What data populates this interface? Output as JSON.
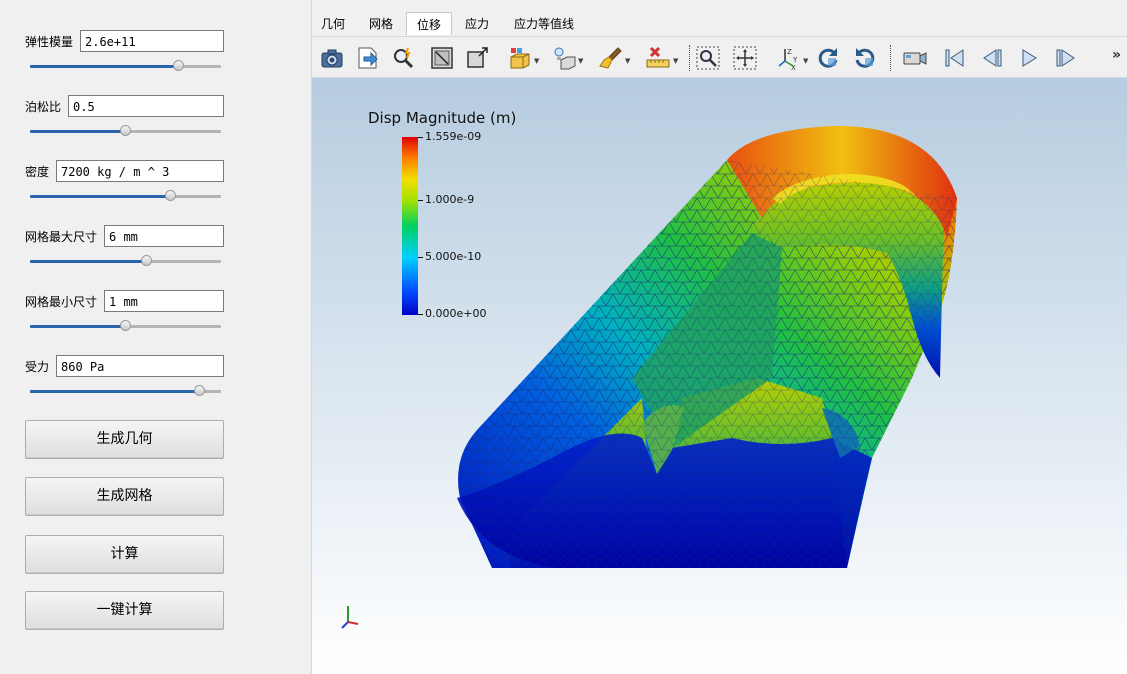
{
  "params": [
    {
      "label": "弹性模量",
      "value": "2.6e+11",
      "slider": 0.78
    },
    {
      "label": "泊松比",
      "value": "0.5",
      "slider": 0.5
    },
    {
      "label": "密度",
      "value": "7200 kg / m ^ 3",
      "slider": 0.74
    },
    {
      "label": "网格最大尺寸",
      "value": "6 mm",
      "slider": 0.61
    },
    {
      "label": "网格最小尺寸",
      "value": "1 mm",
      "slider": 0.5
    },
    {
      "label": "受力",
      "value": "860 Pa",
      "slider": 0.89
    }
  ],
  "buttons": {
    "gen_geometry": "生成几何",
    "gen_mesh": "生成网格",
    "compute": "计算",
    "one_click": "一键计算"
  },
  "tabs": [
    "几何",
    "网格",
    "位移",
    "应力",
    "应力等值线"
  ],
  "active_tab": "位移",
  "toolbar_overflow": "»",
  "toolbar_icons": [
    "camera-icon",
    "save-screenshot-icon",
    "find-data-icon",
    "reset-camera-icon",
    "zoom-to-box-icon",
    "cube-color-icon",
    "lightbulb-icon",
    "paint-brush-icon",
    "delete-ruler-icon",
    "zoom-select-icon",
    "fit-view-icon",
    "axes-orientation-icon",
    "rotate-cw-icon",
    "rotate-ccw-icon",
    "video-camera-icon",
    "first-frame-icon",
    "previous-frame-icon",
    "play-icon",
    "last-frame-icon"
  ],
  "legend": {
    "title": "Disp Magnitude (m)",
    "ticks": [
      "1.559e-09",
      "1.000e-9",
      "5.000e-10",
      "0.000e+00"
    ],
    "colors": {
      "max": "#e00000",
      "high": "#f0e000",
      "mid": "#00d060",
      "low": "#0000c8"
    }
  },
  "colors": {
    "accent": "#2a64ad"
  }
}
